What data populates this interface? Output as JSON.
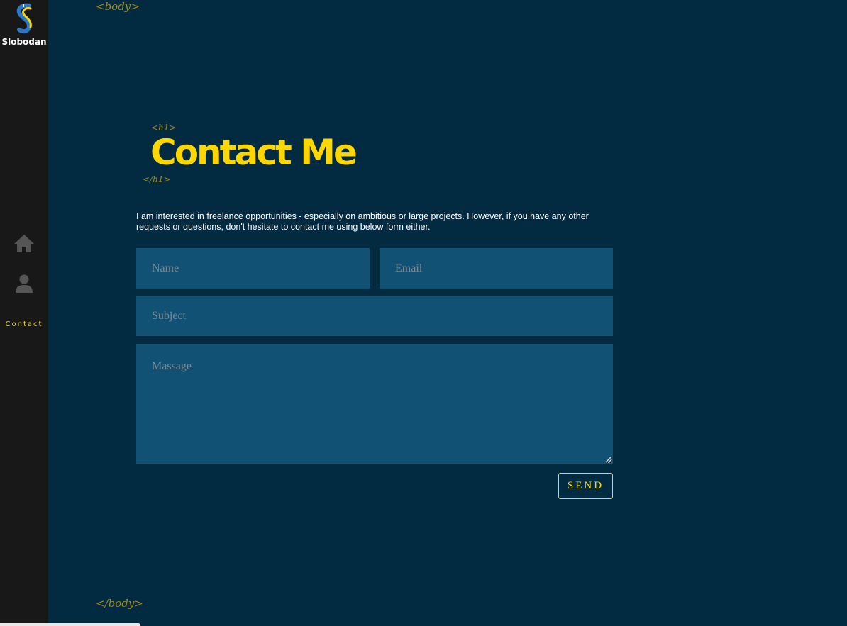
{
  "sidebar": {
    "logo_name": "Slobodan",
    "nav": {
      "home_icon": "home-icon",
      "about_icon": "user-icon",
      "contact_label": "Contact"
    }
  },
  "tags": {
    "body_open": "<body>",
    "body_close": "</body>",
    "h1_open": "<h1>",
    "h1_close": "</h1>"
  },
  "page": {
    "title": "Contact Me",
    "intro": "I am interested in freelance opportunities - especially on ambitious or large projects. However, if you have any other requests or questions, don't hesitate to contact me using below form either."
  },
  "form": {
    "name_placeholder": "Name",
    "email_placeholder": "Email",
    "subject_placeholder": "Subject",
    "message_placeholder": "Massage",
    "send_label": "SEND"
  },
  "colors": {
    "background": "#022b42",
    "sidebar": "#181818",
    "accent": "#ffd700",
    "field": "#115173",
    "tag": "#a08c16"
  }
}
